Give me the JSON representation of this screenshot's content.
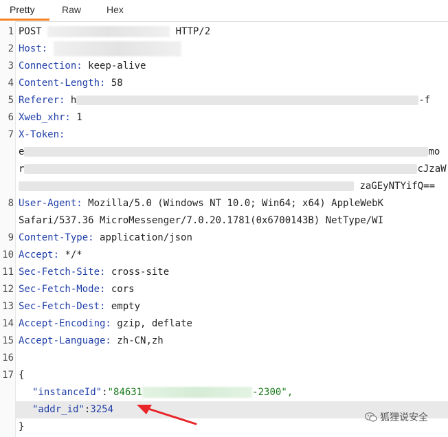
{
  "tabs": [
    {
      "label": "Pretty",
      "active": true
    },
    {
      "label": "Raw",
      "active": false
    },
    {
      "label": "Hex",
      "active": false
    }
  ],
  "request": {
    "line1_method": "POST",
    "line1_protocol": "HTTP/2",
    "host_key": "Host:",
    "connection_key": "Connection:",
    "connection_val": "keep-alive",
    "content_length_key": "Content-Length:",
    "content_length_val": "58",
    "referer_key": "Referer:",
    "referer_val_start": "h",
    "referer_val_end": "-f",
    "xweb_key": "Xweb_xhr:",
    "xweb_val": "1",
    "xtoken_key": "X-Token:",
    "xtoken_l1_start": "e",
    "xtoken_l1_end": "mo",
    "xtoken_l2_start": "r",
    "xtoken_l2_end": "cJzaW",
    "xtoken_l3_end": "zaGEyNTYifQ==",
    "ua_key": "User-Agent:",
    "ua_val1": "Mozilla/5.0 (Windows NT 10.0; Win64; x64) AppleWebK",
    "ua_val2": "Safari/537.36 MicroMessenger/7.0.20.1781(0x6700143B) NetType/WI",
    "ctype_key": "Content-Type:",
    "ctype_val": "application/json",
    "accept_key": "Accept:",
    "accept_val": "*/*",
    "sfs_key": "Sec-Fetch-Site:",
    "sfs_val": "cross-site",
    "sfm_key": "Sec-Fetch-Mode:",
    "sfm_val": "cors",
    "sfd_key": "Sec-Fetch-Dest:",
    "sfd_val": "empty",
    "ae_key": "Accept-Encoding:",
    "ae_val": "gzip, deflate",
    "al_key": "Accept-Language:",
    "al_val": "zh-CN,zh",
    "brace_open": "{",
    "brace_close": "}",
    "instance_key": "\"instanceId\"",
    "instance_val_start": "\"84631",
    "instance_val_end": "-2300\",",
    "addr_key": "\"addr_id\"",
    "addr_val": "3254"
  },
  "line_numbers": [
    "1",
    "2",
    "3",
    "4",
    "5",
    "6",
    "7",
    "8",
    "9",
    "10",
    "11",
    "12",
    "13",
    "14",
    "15",
    "16",
    "17"
  ],
  "watermark": {
    "text": "狐狸说安全",
    "icon": "wechat-icon"
  },
  "colors": {
    "accent": "#f58220",
    "arrow": "#e8262a",
    "key": "#1f3ea8",
    "string": "#1a7a1a"
  }
}
